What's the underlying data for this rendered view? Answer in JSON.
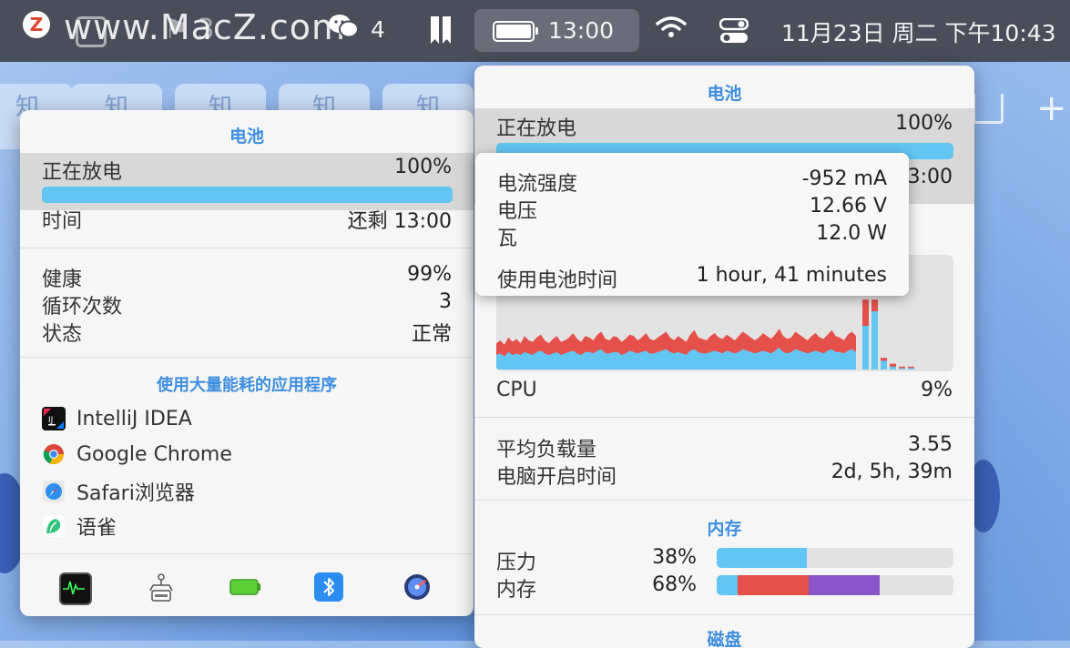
{
  "menubar": {
    "z_label": "Z",
    "watermark": "www.MacZ.com",
    "icon_b_count": "3",
    "wechat_count": "4",
    "battery_time": "13:00",
    "datetime": "11月23日 周二 下午10:43"
  },
  "background": {
    "tab_label": "知",
    "plus": "+"
  },
  "battery_panel": {
    "title": "电池",
    "state_label": "正在放电",
    "state_value": "100%",
    "charge_percent": 100,
    "time_label": "时间",
    "time_value": "还剩 13:00",
    "health_label": "健康",
    "health_value": "99%",
    "cycles_label": "循环次数",
    "cycles_value": "3",
    "status_label": "状态",
    "status_value": "正常",
    "apps_title": "使用大量能耗的应用程序",
    "apps": [
      {
        "name": "IntelliJ IDEA",
        "icon": "intellij-icon"
      },
      {
        "name": "Google Chrome",
        "icon": "chrome-icon"
      },
      {
        "name": "Safari浏览器",
        "icon": "safari-icon"
      },
      {
        "name": "语雀",
        "icon": "yuque-icon"
      }
    ],
    "bottom_icons": [
      "activity-monitor-icon",
      "network-icon",
      "battery-icon",
      "bluetooth-icon",
      "disk-icon"
    ]
  },
  "right_panel": {
    "title": "电池",
    "state_label": "正在放电",
    "state_value": "100%",
    "time_value_partial": "3:00",
    "cpu_label": "CPU",
    "cpu_value": "9%",
    "load_label": "平均负载量",
    "load_value": "3.55",
    "uptime_label": "电脑开启时间",
    "uptime_value": "2d, 5h, 39m",
    "memory_title": "内存",
    "pressure_label": "压力",
    "pressure_value": "38%",
    "memory_label": "内存",
    "memory_value": "68%",
    "disk_title": "磁盘",
    "colors": {
      "blue": "#63c6f2",
      "red": "#e6504a",
      "purple": "#8a55c8"
    }
  },
  "tooltip": {
    "current_label": "电流强度",
    "current_value": "-952 mA",
    "voltage_label": "电压",
    "voltage_value": "12.66 V",
    "watt_label": "瓦",
    "watt_value": "12.0 W",
    "usage_label": "使用电池时间",
    "usage_value": "1 hour, 41 minutes"
  },
  "chart_data": {
    "type": "area",
    "title": "CPU",
    "series": [
      {
        "name": "",
        "values": [
          18,
          20,
          17,
          22,
          19,
          21,
          18,
          23,
          20,
          19,
          22,
          24,
          20,
          18,
          21,
          23,
          19,
          20,
          22,
          25,
          21,
          19,
          23,
          22,
          20,
          24,
          26,
          21,
          20,
          23,
          22,
          19,
          21,
          24,
          23,
          20,
          22,
          25,
          21,
          20,
          22,
          24,
          26,
          22,
          20,
          23,
          21,
          19,
          24,
          27,
          22,
          21,
          20,
          23,
          25,
          22,
          21,
          24,
          22,
          20,
          23,
          26,
          24,
          22,
          20,
          22,
          25,
          23,
          21,
          24,
          28,
          23,
          21,
          22,
          26,
          24,
          22,
          20,
          23,
          25,
          22,
          21,
          24,
          27,
          23,
          22,
          20,
          24,
          26,
          23
        ]
      },
      {
        "name": "",
        "values": [
          10,
          11,
          9,
          12,
          10,
          11,
          10,
          12,
          11,
          10,
          12,
          13,
          11,
          10,
          11,
          12,
          10,
          11,
          12,
          13,
          11,
          10,
          12,
          12,
          11,
          13,
          14,
          11,
          11,
          12,
          12,
          10,
          11,
          13,
          12,
          11,
          12,
          13,
          11,
          11,
          12,
          13,
          14,
          12,
          11,
          12,
          11,
          10,
          13,
          14,
          12,
          11,
          11,
          12,
          13,
          12,
          11,
          13,
          12,
          11,
          12,
          14,
          13,
          12,
          11,
          12,
          13,
          12,
          11,
          13,
          15,
          12,
          11,
          12,
          14,
          13,
          12,
          11,
          12,
          13,
          12,
          11,
          13,
          14,
          12,
          12,
          11,
          13,
          14,
          12
        ]
      }
    ],
    "mini_bars": [
      [
        48,
        30
      ],
      [
        48,
        40
      ],
      [
        8,
        6
      ],
      [
        4,
        2
      ],
      [
        2,
        1
      ],
      [
        2,
        1
      ]
    ],
    "ylim": [
      0,
      100
    ]
  },
  "memory_bars": {
    "pressure": [
      {
        "value": 38,
        "color": "#63c6f2"
      }
    ],
    "memory": [
      {
        "value": 9,
        "color": "#63c6f2"
      },
      {
        "value": 30,
        "color": "#e6504a"
      },
      {
        "value": 30,
        "color": "#8a55c8"
      }
    ]
  }
}
